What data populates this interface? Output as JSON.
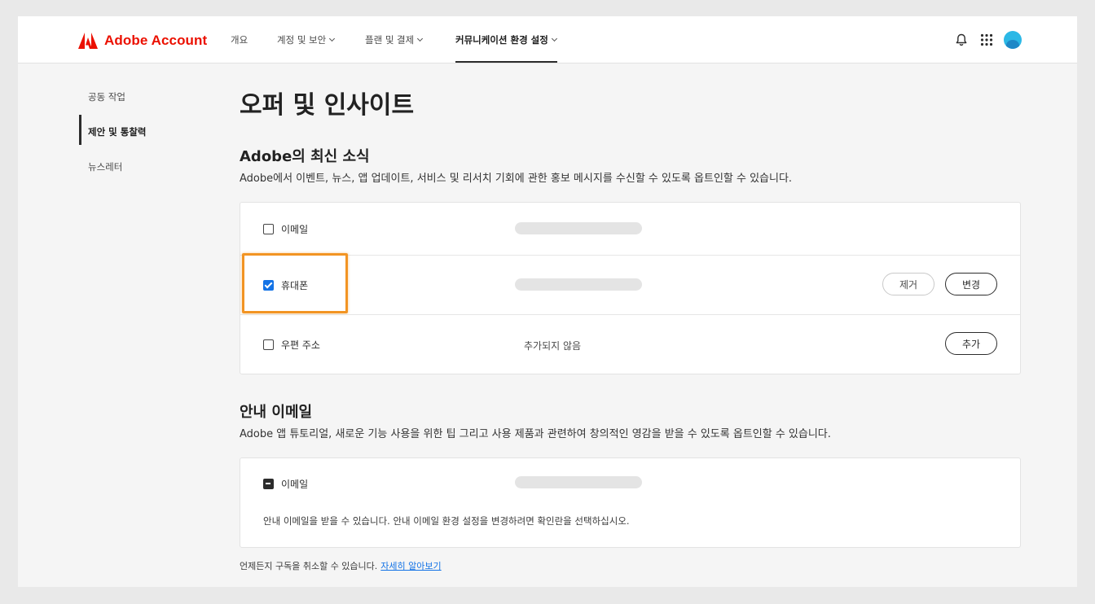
{
  "header": {
    "brand_name": "Adobe Account",
    "brand_color": "#eb1000",
    "nav": [
      {
        "label": "개요",
        "has_dropdown": false,
        "active": false
      },
      {
        "label": "계정 및 보안",
        "has_dropdown": true,
        "active": false
      },
      {
        "label": "플랜 및 결제",
        "has_dropdown": true,
        "active": false
      },
      {
        "label": "커뮤니케이션 환경 설정",
        "has_dropdown": true,
        "active": true
      }
    ],
    "icons": [
      "bell-icon",
      "app-grid-icon",
      "avatar"
    ]
  },
  "sidebar": {
    "items": [
      {
        "label": "공동 작업",
        "active": false
      },
      {
        "label": "제안 및 통찰력",
        "active": true
      },
      {
        "label": "뉴스레터",
        "active": false
      }
    ]
  },
  "main": {
    "title": "오퍼 및 인사이트",
    "news_section": {
      "heading": "Adobe의 최신 소식",
      "description": "Adobe에서 이벤트, 뉴스, 앱 업데이트, 서비스 및 리서치 기회에 관한 홍보 메시지를 수신할 수 있도록 옵트인할 수 있습니다.",
      "rows": [
        {
          "label": "이메일",
          "checked": false,
          "value_hidden": true,
          "status": "",
          "buttons": []
        },
        {
          "label": "휴대폰",
          "checked": true,
          "value_hidden": true,
          "status": "",
          "buttons": [
            "제거",
            "변경"
          ]
        },
        {
          "label": "우편 주소",
          "checked": false,
          "value_hidden": false,
          "status": "추가되지 않음",
          "buttons": [
            "추가"
          ]
        }
      ]
    },
    "guide_section": {
      "heading": "안내 이메일",
      "description": "Adobe 앱 튜토리얼, 새로운 기능 사용을 위한 팁 그리고 사용 제품과 관련하여 창의적인 영감을 받을 수 있도록 옵트인할 수 있습니다.",
      "row_label": "이메일",
      "checkbox_state": "indeterminate",
      "note": "안내 이메일을 받을 수 있습니다. 안내 이메일 환경 설정을 변경하려면 확인란을 선택하십시오."
    },
    "footer": {
      "text": "언제든지 구독을 취소할 수 있습니다.",
      "link": "자세히 알아보기"
    }
  },
  "colors": {
    "accent_blue": "#1473e6",
    "highlight_orange": "#f29423",
    "avatar": "#2bb8e6"
  }
}
